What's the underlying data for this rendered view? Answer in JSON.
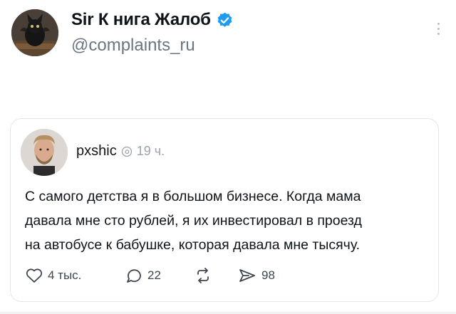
{
  "post": {
    "display_name": "Sir К нига Жалоб",
    "handle": "@complaints_ru",
    "verified_icon": "verified-badge-icon",
    "accent_color": "#1d9bf0"
  },
  "quoted": {
    "username": "pxshic",
    "time": "19 ч.",
    "text_lines": [
      "С самого детства я в большом бизнесе. Когда мама",
      "давала мне сто рублей, я их инвестировал в проезд",
      "на автобусе к бабушке, которая давала мне тысячу."
    ],
    "actions": {
      "likes": "4 тыс.",
      "replies": "22",
      "reposts": "",
      "shares": "98"
    }
  }
}
